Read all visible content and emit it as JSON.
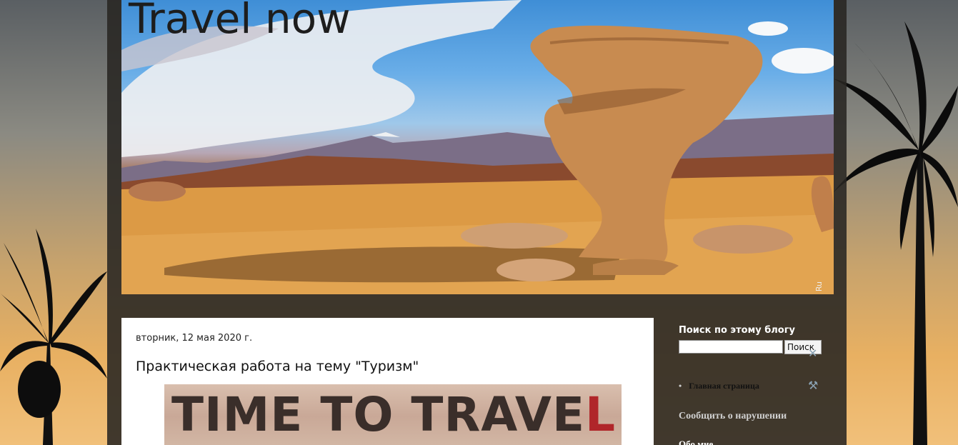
{
  "header": {
    "blog_title": "Travel now",
    "image_mark": "Ru"
  },
  "post": {
    "date": "вторник, 12 мая 2020 г.",
    "title": "Практическая работа на тему \"Туризм\"",
    "image_text_main": "TIME TO TRAVE",
    "image_text_red": "L"
  },
  "sidebar": {
    "search_title": "Поиск по этому блогу",
    "search_button": "Поиск",
    "pages": [
      {
        "label": "Главная страница"
      }
    ],
    "report_link": "Сообщить о нарушении",
    "about_title": "Обо мне"
  },
  "icons": {
    "search_tool": "wrench-icon",
    "pages_tool": "wrench-icon"
  },
  "colors": {
    "outer_bg": "#28261f",
    "post_bg": "#ffffff",
    "title_text": "#1d1d1d"
  }
}
